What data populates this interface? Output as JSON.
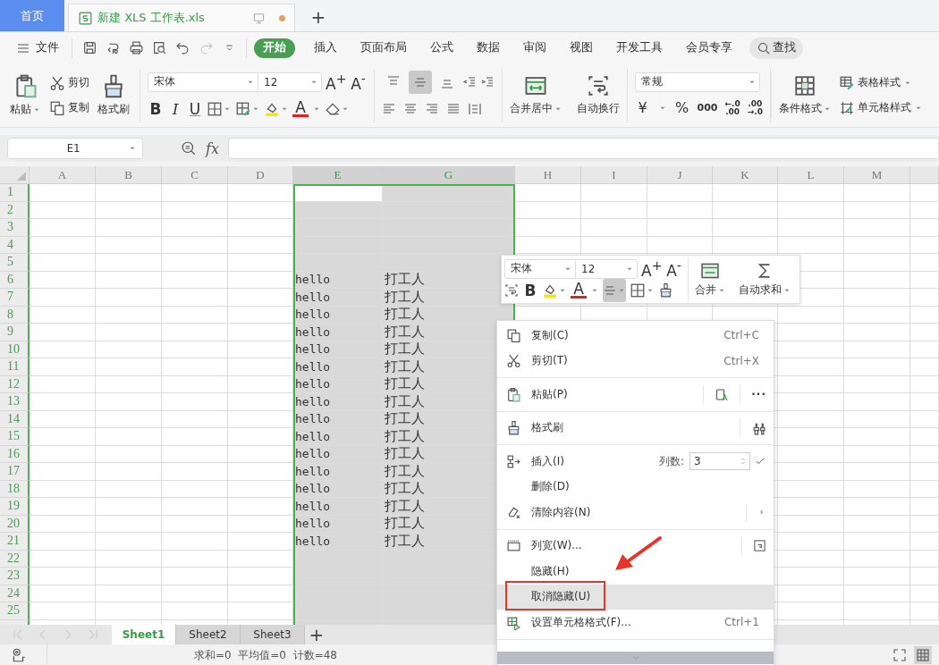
{
  "tabs_bar": {
    "home": "首页",
    "document": {
      "title": "新建 XLS 工作表.xls",
      "modified": true
    },
    "new_tab": "+"
  },
  "menu": {
    "file": "文件",
    "quick_access": [
      {
        "kind": "save",
        "disabled": false
      },
      {
        "kind": "convert",
        "disabled": false
      },
      {
        "kind": "print",
        "disabled": false
      },
      {
        "kind": "preview",
        "disabled": false
      },
      {
        "kind": "undo",
        "disabled": false
      },
      {
        "kind": "redo",
        "disabled": true
      },
      {
        "kind": "customize",
        "disabled": false
      }
    ],
    "tabs": [
      {
        "label": "开始",
        "selected": true
      },
      {
        "label": "插入",
        "selected": false
      },
      {
        "label": "页面布局",
        "selected": false
      },
      {
        "label": "公式",
        "selected": false
      },
      {
        "label": "数据",
        "selected": false
      },
      {
        "label": "审阅",
        "selected": false
      },
      {
        "label": "视图",
        "selected": false
      },
      {
        "label": "开发工具",
        "selected": false
      },
      {
        "label": "会员专享",
        "selected": false
      }
    ],
    "search": "查找"
  },
  "ribbon": {
    "paste": "粘贴",
    "cut": "剪切",
    "copy": "复制",
    "format_painter": "格式刷",
    "font": "宋体",
    "size": "12",
    "grow": "A$^{+}$",
    "shrink": "A$^{-}$",
    "bold": "B",
    "italic": "I",
    "underline": "U",
    "font_color": "A",
    "vertical_align": [
      {
        "kind": "top",
        "selected": false
      },
      {
        "kind": "middle",
        "selected": true
      },
      {
        "kind": "bottom",
        "selected": false
      }
    ],
    "merge": "合并居中",
    "wrap": "自动换行",
    "number_format": "常规",
    "currency": "¥",
    "percent": "%",
    "thousands": "000",
    "increase_decimal": [
      "←.0",
      ".00"
    ],
    "decrease_decimal": [
      ".00",
      "→.0"
    ],
    "conditional_format": "条件格式",
    "table_style": "表格样式",
    "cell_style": "单元格样式"
  },
  "formula_bar": {
    "name_box": "E1",
    "function_label": "fx"
  },
  "sheet": {
    "columns": [
      {
        "label": "A",
        "selected": false
      },
      {
        "label": "B",
        "selected": false
      },
      {
        "label": "C",
        "selected": false
      },
      {
        "label": "D",
        "selected": false
      },
      {
        "label": "E",
        "selected": true
      },
      {
        "label": "G",
        "selected": true
      },
      {
        "label": "H",
        "selected": false
      },
      {
        "label": "I",
        "selected": false
      },
      {
        "label": "J",
        "selected": false
      },
      {
        "label": "K",
        "selected": false
      },
      {
        "label": "L",
        "selected": false
      },
      {
        "label": "M",
        "selected": false
      }
    ],
    "rows": [
      {
        "label": "1",
        "active": true
      },
      {
        "label": "2",
        "active": false
      },
      {
        "label": "3",
        "active": false
      },
      {
        "label": "4",
        "active": false
      },
      {
        "label": "5",
        "active": false
      },
      {
        "label": "6",
        "active": false,
        "cells": [
          "hello",
          "打工人"
        ]
      },
      {
        "label": "7",
        "active": false,
        "cells": [
          "hello",
          "打工人"
        ]
      },
      {
        "label": "8",
        "active": false,
        "cells": [
          "hello",
          "打工人"
        ]
      },
      {
        "label": "9",
        "active": false,
        "cells": [
          "hello",
          "打工人"
        ]
      },
      {
        "label": "10",
        "active": false,
        "cells": [
          "hello",
          "打工人"
        ]
      },
      {
        "label": "11",
        "active": false,
        "cells": [
          "hello",
          "打工人"
        ]
      },
      {
        "label": "12",
        "active": false,
        "cells": [
          "hello",
          "打工人"
        ]
      },
      {
        "label": "13",
        "active": false,
        "cells": [
          "hello",
          "打工人"
        ]
      },
      {
        "label": "14",
        "active": false,
        "cells": [
          "hello",
          "打工人"
        ]
      },
      {
        "label": "15",
        "active": false,
        "cells": [
          "hello",
          "打工人"
        ]
      },
      {
        "label": "16",
        "active": false,
        "cells": [
          "hello",
          "打工人"
        ]
      },
      {
        "label": "17",
        "active": false,
        "cells": [
          "hello",
          "打工人"
        ]
      },
      {
        "label": "18",
        "active": false,
        "cells": [
          "hello",
          "打工人"
        ]
      },
      {
        "label": "19",
        "active": false,
        "cells": [
          "hello",
          "打工人"
        ]
      },
      {
        "label": "20",
        "active": false,
        "cells": [
          "hello",
          "打工人"
        ]
      },
      {
        "label": "21",
        "active": false,
        "cells": [
          "hello",
          "打工人"
        ]
      },
      {
        "label": "22",
        "active": false
      },
      {
        "label": "23",
        "active": false
      },
      {
        "label": "24",
        "active": false
      },
      {
        "label": "25",
        "active": false
      }
    ]
  },
  "mini_toolbar": {
    "font": "宋体",
    "size": "12",
    "grow": "A$^{+}$",
    "shrink": "A$^{-}$",
    "bold": "B",
    "font_color": "A",
    "align_selected": true,
    "merge": "合并",
    "autosum": "自动求和"
  },
  "context_menu": {
    "items": [
      {
        "kind": "copy",
        "label": "复制(C)",
        "shortcut": "Ctrl+C",
        "selected": false,
        "divider_after": false
      },
      {
        "kind": "cut",
        "label": "剪切(T)",
        "shortcut": "Ctrl+X",
        "selected": false,
        "divider_after": true
      },
      {
        "kind": "paste",
        "label": "粘贴(P)",
        "more": "···",
        "selected": false,
        "divider_after": true
      },
      {
        "kind": "painter",
        "label": "格式刷",
        "selected": false,
        "divider_after": true
      },
      {
        "kind": "insert",
        "label": "插入(I)",
        "count_label": "列数:",
        "count": "3",
        "selected": false,
        "divider_after": false
      },
      {
        "kind": "plain",
        "label": "删除(D)",
        "selected": false,
        "divider_after": false
      },
      {
        "kind": "clear",
        "label": "清除内容(N)",
        "submenu": true,
        "selected": false,
        "divider_after": true
      },
      {
        "kind": "width",
        "label": "列宽(W)...",
        "selected": false,
        "divider_after": false
      },
      {
        "kind": "plain",
        "label": "隐藏(H)",
        "selected": false,
        "divider_after": false
      },
      {
        "kind": "plain",
        "label": "取消隐藏(U)",
        "selected": true,
        "divider_after": false
      },
      {
        "kind": "format",
        "label": "设置单元格格式(F)...",
        "shortcut": "Ctrl+1",
        "selected": false,
        "divider_after": true
      }
    ]
  },
  "sheet_tabs": [
    {
      "label": "Sheet1",
      "selected": true
    },
    {
      "label": "Sheet2",
      "selected": false
    },
    {
      "label": "Sheet3",
      "selected": false
    }
  ],
  "add_sheet": "+",
  "status_bar": {
    "summary": "求和=0  平均值=0  计数=48"
  }
}
